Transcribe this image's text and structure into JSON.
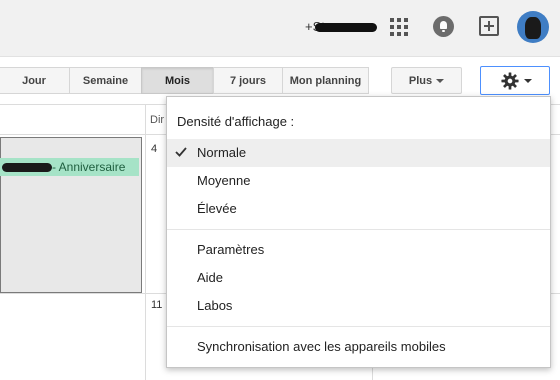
{
  "header": {
    "user_name": "+St",
    "icons": [
      "apps-grid-icon",
      "notifications-bell-icon",
      "share-add-icon",
      "avatar"
    ]
  },
  "view_buttons": [
    {
      "label": "Jour",
      "active": false
    },
    {
      "label": "Semaine",
      "active": false
    },
    {
      "label": "Mois",
      "active": true
    },
    {
      "label": "7 jours",
      "active": false
    },
    {
      "label": "Mon planning",
      "active": false
    }
  ],
  "more_button": {
    "label": "Plus"
  },
  "settings_button": {
    "icon": "gear-icon"
  },
  "calendar": {
    "day_header": "Dir",
    "day_numbers": [
      "4",
      "11"
    ],
    "event": {
      "label": "- Anniversaire",
      "color": "#a6e3c7"
    }
  },
  "settings_menu": {
    "density_title": "Densité d'affichage :",
    "density_options": [
      {
        "label": "Normale",
        "selected": true
      },
      {
        "label": "Moyenne",
        "selected": false
      },
      {
        "label": "Élevée",
        "selected": false
      }
    ],
    "links": [
      "Paramètres",
      "Aide",
      "Labos"
    ],
    "sync_label": "Synchronisation avec les appareils mobiles"
  },
  "colors": {
    "accent_blue": "#4d90fe",
    "event_green": "#a6e3c7"
  }
}
